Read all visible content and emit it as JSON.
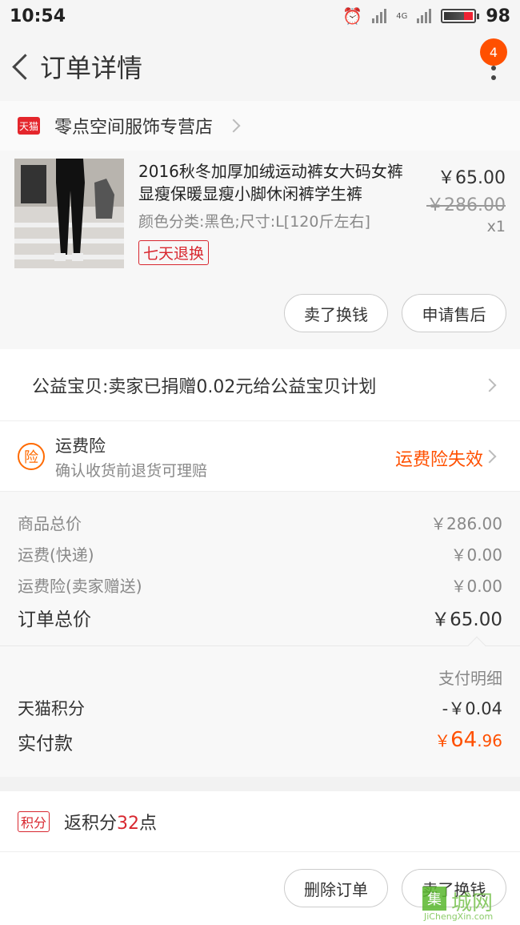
{
  "status_bar": {
    "time": "10:54",
    "network": "4G",
    "battery": "98"
  },
  "nav": {
    "title": "订单详情",
    "badge_count": "4"
  },
  "shop": {
    "logo_text": "天猫",
    "name": "零点空间服饰专营店"
  },
  "product": {
    "title": "2016秋冬加厚加绒运动裤女大码女裤显瘦保暖显瘦小脚休闲裤学生裤",
    "spec": "颜色分类:黑色;尺寸:L[120斤左右]",
    "tag": "七天退换",
    "price": "￥65.00",
    "original_price": "￥286.00",
    "quantity": "x1",
    "buttons": {
      "sell": "卖了换钱",
      "after_sale": "申请售后"
    }
  },
  "charity": {
    "text": "公益宝贝:卖家已捐赠0.02元给公益宝贝计划"
  },
  "insurance": {
    "icon_text": "险",
    "title": "运费险",
    "subtitle": "确认收货前退货可理赔",
    "status": "运费险失效"
  },
  "costs": {
    "rows": [
      {
        "label": "商品总价",
        "value": "￥286.00"
      },
      {
        "label": "运费(快递)",
        "value": "￥0.00"
      },
      {
        "label": "运费险(卖家赠送)",
        "value": "￥0.00"
      }
    ],
    "total_label": "订单总价",
    "total_value": "￥65.00"
  },
  "payment": {
    "detail_label": "支付明细",
    "points_label": "天猫积分",
    "points_value": "-￥0.04",
    "paid_label": "实付款",
    "paid_currency": "￥",
    "paid_int": "64",
    "paid_dec": ".96"
  },
  "points": {
    "tag": "积分",
    "text_prefix": "返积分",
    "number": "32",
    "text_suffix": "点"
  },
  "bottom": {
    "delete": "删除订单",
    "sell": "卖了换钱"
  },
  "watermark": {
    "mark": "集",
    "name": "城网",
    "url": "JiChengXin.com"
  },
  "colors": {
    "accent": "#ff5000",
    "tmall_red": "#d8272f"
  }
}
